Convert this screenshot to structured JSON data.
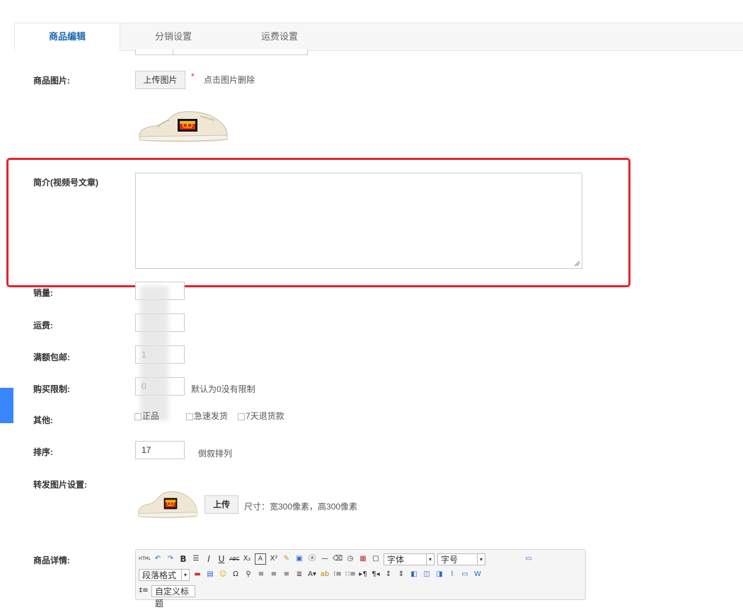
{
  "tabs": [
    {
      "label": "商品编辑",
      "active": true
    },
    {
      "label": "分销设置",
      "active": false
    },
    {
      "label": "运费设置",
      "active": false
    }
  ],
  "image_field": {
    "label": "商品图片:",
    "upload_button": "上传图片",
    "required_mark": "*",
    "hint": "点击图片删除"
  },
  "intro_field": {
    "label": "简介(视频号文章)",
    "value": ""
  },
  "sales_field": {
    "label": "销量:",
    "value": ""
  },
  "freight_field": {
    "label": "运费:",
    "value": ""
  },
  "free_shipping_field": {
    "label": "满额包邮:",
    "value": "1"
  },
  "purchase_limit_field": {
    "label": "购买限制:",
    "value": "0",
    "hint": "默认为0没有限制"
  },
  "other_field": {
    "label": "其他:",
    "options": [
      {
        "label": "正品",
        "checked": false
      },
      {
        "label": "急速发货",
        "checked": false
      },
      {
        "label": "7天退货款",
        "checked": false
      }
    ]
  },
  "sort_field": {
    "label": "排序:",
    "value": "17",
    "hint": "倒叙排列"
  },
  "share_image_field": {
    "label": "转发图片设置:",
    "upload_button": "上传",
    "hint": "尺寸：宽300像素，高300像素"
  },
  "detail_field": {
    "label": "商品详情:",
    "font_select": "字体",
    "size_select": "字号",
    "paragraph_select": "段落格式",
    "custom_title_select": "自定义标题"
  },
  "colors": {
    "highlight": "#e8232a",
    "tab_active": "#1c6ab0",
    "side_accent": "#3a86ff"
  }
}
